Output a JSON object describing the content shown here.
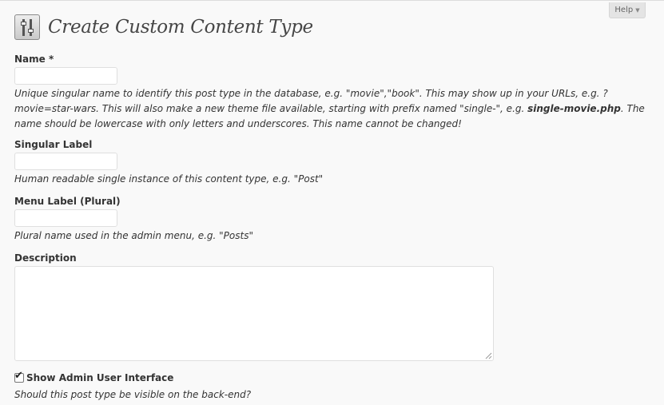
{
  "help": {
    "label": "Help",
    "arrow": "▼"
  },
  "page": {
    "title": "Create Custom Content Type",
    "icon": "tools-icon"
  },
  "fields": {
    "name": {
      "label": "Name *",
      "value": "",
      "description_part1": "Unique singular name to identify this post type in the database, e.g. \"movie\",\"book\". This may show up in your URLs, e.g. ?movie=star-wars. This will also make a new theme file available, starting with prefix named \"single-\", e.g. ",
      "description_bold": "single-movie.php",
      "description_part2": ". The name should be lowercase with only letters and underscores. This name cannot be changed!"
    },
    "singular_label": {
      "label": "Singular Label",
      "value": "",
      "description": "Human readable single instance of this content type, e.g. \"Post\""
    },
    "menu_label": {
      "label": "Menu Label (Plural)",
      "value": "",
      "description": "Plural name used in the admin menu, e.g. \"Posts\""
    },
    "description": {
      "label": "Description",
      "value": ""
    },
    "show_ui": {
      "label": "Show Admin User Interface",
      "checked": true,
      "description": "Should this post type be visible on the back-end?"
    }
  }
}
